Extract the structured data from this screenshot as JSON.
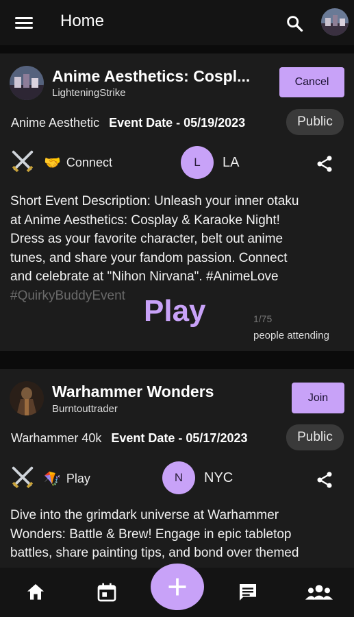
{
  "appbar": {
    "title": "Home",
    "menu_icon": "menu-icon",
    "search_icon": "search-icon"
  },
  "events": [
    {
      "title": "Anime Aesthetics: Cospl...",
      "user": "LighteningStrike",
      "action_label": "Cancel",
      "category": "Anime Aesthetic",
      "event_date": "Event Date - 05/19/2023",
      "visibility": "Public",
      "type_icon": "handshake-icon",
      "type_label": "Connect",
      "location_initial": "L",
      "location": "LA",
      "description_lines": [
        "Short Event Description: Unleash your inner otaku",
        "at Anime Aesthetics: Cosplay & Karaoke Night!",
        "Dress as your favorite character, belt out anime",
        "tunes, and share your fandom passion. Connect",
        "and celebrate at \"Nihon Nirvana\". #AnimeLove"
      ],
      "description_faded": "#QuirkyBuddyEvent",
      "overlay_label": "Play",
      "attendance": "1/75",
      "attending_label": "people attending"
    },
    {
      "title": "Warhammer Wonders",
      "user": "Burntouttrader",
      "action_label": "Join",
      "category": "Warhammer 40k",
      "event_date": "Event Date - 05/17/2023",
      "visibility": "Public",
      "type_icon": "kite-icon",
      "type_label": "Play",
      "location_initial": "N",
      "location": "NYC",
      "description_lines": [
        "Dive into the grimdark universe at Warhammer",
        "Wonders: Battle & Brew! Engage in epic tabletop",
        "battles, share painting tips, and bond over themed"
      ]
    }
  ],
  "bottom_nav": [
    "home-icon",
    "calendar-icon",
    "add-icon",
    "chat-icon",
    "groups-icon"
  ],
  "colors": {
    "accent": "#c8a2f8",
    "background": "#0b0b0b",
    "card": "#1c1c1c",
    "bar": "#141414"
  }
}
